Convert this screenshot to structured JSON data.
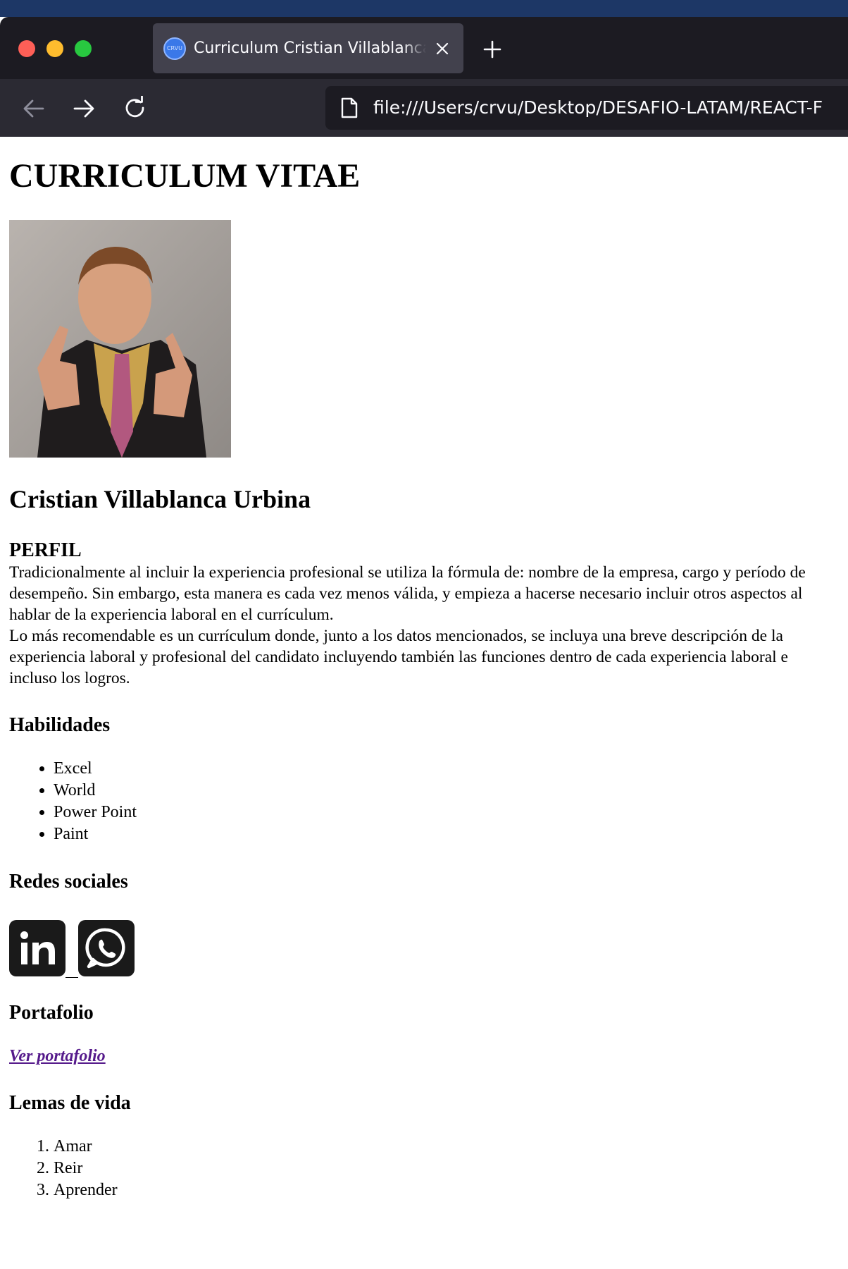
{
  "browser": {
    "tab": {
      "favicon_text": "CRVU",
      "title": "Curriculum Cristian Villablanca Urbina"
    },
    "url": "file:///Users/crvu/Desktop/DESAFIO-LATAM/REACT-F"
  },
  "cv": {
    "title": "CURRICULUM VITAE",
    "photo_alt": "Foto de perfil",
    "name": "Cristian Villablanca Urbina",
    "perfil": {
      "heading": "PERFIL",
      "paragraphs": [
        "Tradicionalmente al incluir la experiencia profesional se utiliza la fórmula de: nombre de la empresa, cargo y período de desempeño. Sin embargo, esta manera es cada vez menos válida, y empieza a hacerse necesario incluir otros aspectos al hablar de la experiencia laboral en el currículum.",
        "Lo más recomendable es un currículum donde, junto a los datos mencionados, se incluya una breve descripción de la experiencia laboral y profesional del candidato incluyendo también las funciones dentro de cada experiencia laboral e incluso los logros."
      ]
    },
    "habilidades": {
      "heading": "Habilidades",
      "items": [
        "Excel",
        "World",
        "Power Point",
        "Paint"
      ]
    },
    "redes": {
      "heading": "Redes sociales",
      "icons": [
        "linkedin-icon",
        "whatsapp-icon"
      ]
    },
    "portafolio": {
      "heading": "Portafolio",
      "link": "Ver portafolio"
    },
    "lemas": {
      "heading": "Lemas de vida",
      "items": [
        "Amar",
        "Reir",
        "Aprender"
      ]
    }
  },
  "colors": {
    "chrome_bg": "#1c1b22",
    "tab_bg": "#42414d",
    "visited_link": "#551a8b"
  }
}
